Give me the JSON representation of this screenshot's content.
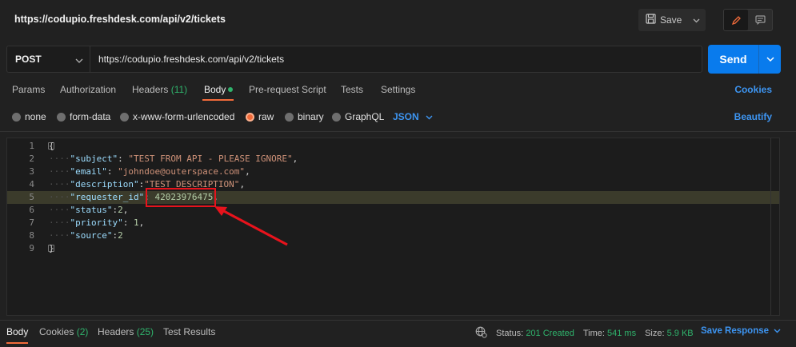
{
  "window": {
    "title": "https://codupio.freshdesk.com/api/v2/tickets"
  },
  "toolbar": {
    "save_label": "Save",
    "save_icon": "save-icon",
    "edit_icon": "pencil-icon",
    "comment_icon": "comment-icon"
  },
  "request": {
    "method": "POST",
    "url": "https://codupio.freshdesk.com/api/v2/tickets",
    "send_label": "Send"
  },
  "tabs": {
    "params": "Params",
    "authorization": "Authorization",
    "headers": "Headers",
    "headers_count": "(11)",
    "body": "Body",
    "prerequest": "Pre-request Script",
    "tests": "Tests",
    "settings": "Settings",
    "cookies": "Cookies"
  },
  "body_types": {
    "none": "none",
    "form_data": "form-data",
    "urlencoded": "x-www-form-urlencoded",
    "raw": "raw",
    "binary": "binary",
    "graphql": "GraphQL",
    "format": "JSON",
    "beautify": "Beautify"
  },
  "editor": {
    "line_numbers": [
      "1",
      "2",
      "3",
      "4",
      "5",
      "6",
      "7",
      "8",
      "9"
    ],
    "lines": {
      "l1_open": "{",
      "l2_key": "\"subject\"",
      "l2_sep": ": ",
      "l2_val": "\"TEST FROM API - PLEASE IGNORE\"",
      "l2_end": ",",
      "l3_key": "\"email\"",
      "l3_sep": ": ",
      "l3_val": "\"johndoe@outerspace.com\"",
      "l3_end": ",",
      "l4_key": "\"description\"",
      "l4_sep": ":",
      "l4_val": "\"TEST DESCRIPTION\"",
      "l4_end": ",",
      "l5_key": "\"requester_id\"",
      "l5_sep": ": ",
      "l5_val": "42023976475",
      "l5_end": ",",
      "l6_key": "\"status\"",
      "l6_sep": ":",
      "l6_val": "2",
      "l6_end": ",",
      "l7_key": "\"priority\"",
      "l7_sep": ": ",
      "l7_val": "1",
      "l7_end": ",",
      "l8_key": "\"source\"",
      "l8_sep": ":",
      "l8_val": "2",
      "l9_close": "}"
    },
    "highlighted_line": 5,
    "annotation_color": "#e8131c"
  },
  "response": {
    "body": "Body",
    "cookies": "Cookies",
    "cookies_count": "(2)",
    "headers": "Headers",
    "headers_count": "(25)",
    "test_results": "Test Results",
    "status_label": "Status:",
    "status_value": "201 Created",
    "time_label": "Time:",
    "time_value": "541 ms",
    "size_label": "Size:",
    "size_value": "5.9 KB",
    "save_response": "Save Response"
  },
  "colors": {
    "accent_orange": "#f26b3a",
    "send_blue": "#097bed",
    "link_blue": "#3d95f2",
    "success_green": "#2fb36c"
  }
}
